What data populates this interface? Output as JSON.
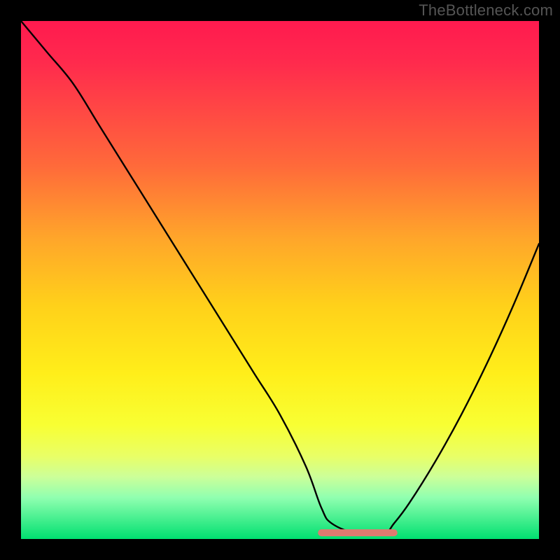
{
  "watermark": "TheBottleneck.com",
  "chart_data": {
    "type": "line",
    "title": "",
    "xlabel": "",
    "ylabel": "",
    "xlim": [
      0,
      100
    ],
    "ylim": [
      0,
      100
    ],
    "series": [
      {
        "name": "curve",
        "x": [
          0,
          5,
          10,
          15,
          20,
          25,
          30,
          35,
          40,
          45,
          50,
          55,
          58,
          60,
          65,
          70,
          72,
          75,
          80,
          85,
          90,
          95,
          100
        ],
        "y": [
          100,
          94,
          88,
          80,
          72,
          64,
          56,
          48,
          40,
          32,
          24,
          14,
          6,
          3,
          1,
          1,
          3,
          7,
          15,
          24,
          34,
          45,
          57
        ]
      },
      {
        "name": "flat-marker",
        "x": [
          58,
          72
        ],
        "y": [
          1.2,
          1.2
        ]
      }
    ],
    "marker_color": "#e07a70",
    "curve_color": "#000000",
    "gradient_stops": [
      {
        "pos": 0,
        "color": "#ff1a4f"
      },
      {
        "pos": 28,
        "color": "#ff6a3a"
      },
      {
        "pos": 55,
        "color": "#ffd11a"
      },
      {
        "pos": 78,
        "color": "#f8ff33"
      },
      {
        "pos": 100,
        "color": "#00e070"
      }
    ]
  }
}
